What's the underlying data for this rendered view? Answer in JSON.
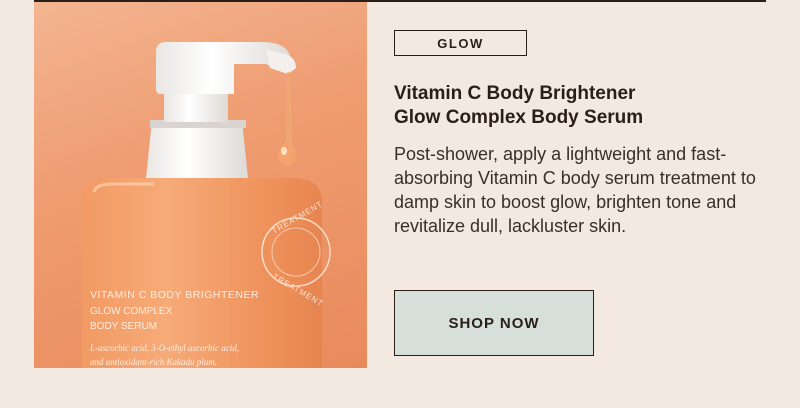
{
  "tag": "GLOW",
  "product": {
    "title_line1": "Vitamin C Body Brightener",
    "title_line2": "Glow Complex Body Serum",
    "description": "Post-shower, apply a lightweight and fast-absorbing Vitamin C body serum treatment to damp skin to boost glow, brighten tone and revitalize dull, lackluster skin."
  },
  "cta": {
    "label": "SHOP NOW"
  },
  "bottle_label": {
    "line1": "VITAMIN C BODY BRIGHTENER",
    "line2": "GLOW COMPLEX",
    "line3": "BODY SERUM",
    "ingredients1": "L-ascorbic acid, 3-O-ethyl ascorbic acid,",
    "ingredients2": "and antioxidant-rich Kakadu plum.",
    "seal1": "TREATMENT",
    "seal2": "TREATMENT"
  },
  "colors": {
    "background": "#f3e9e1",
    "button": "#d6dfda",
    "accent": "#e98a5c"
  }
}
